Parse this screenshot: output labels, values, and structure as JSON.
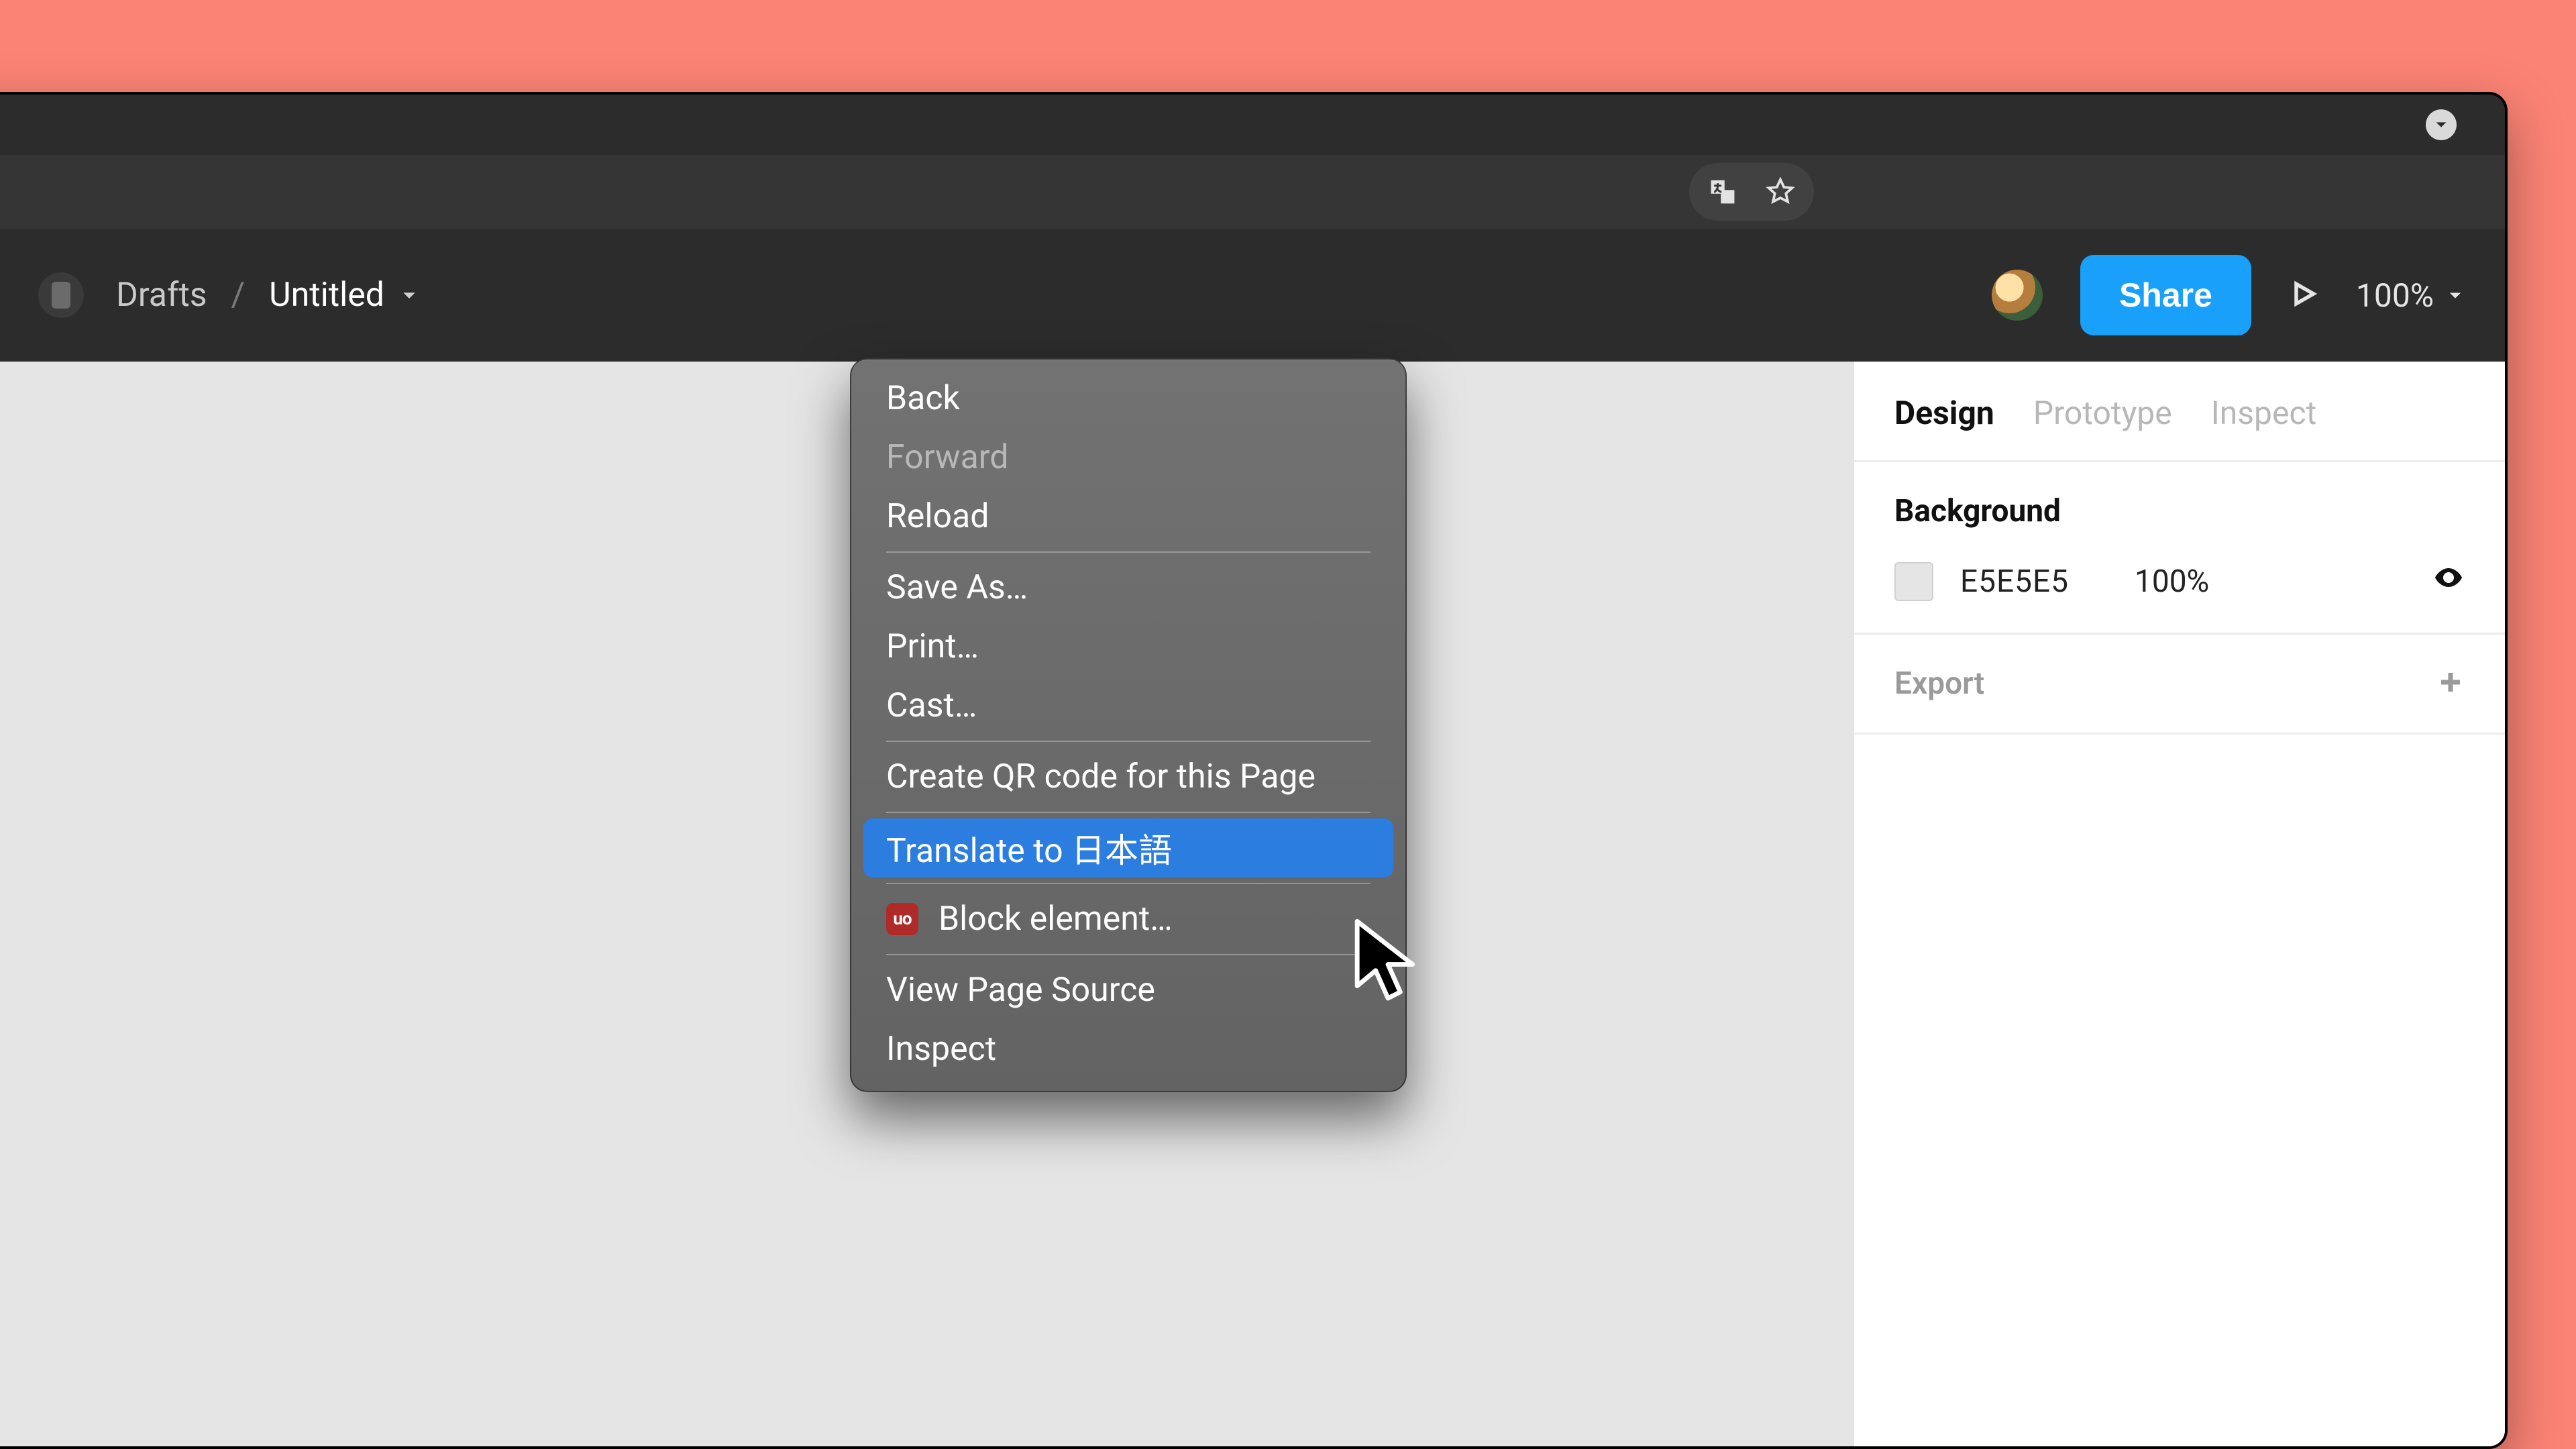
{
  "header": {
    "drafts_label": "Drafts",
    "slash": "/",
    "title": "Untitled",
    "share_label": "Share",
    "zoom_label": "100%"
  },
  "right_panel": {
    "tabs": {
      "design": "Design",
      "prototype": "Prototype",
      "inspect": "Inspect"
    },
    "background": {
      "title": "Background",
      "hex": "E5E5E5",
      "opacity": "100%"
    },
    "export_label": "Export"
  },
  "context_menu": {
    "back": "Back",
    "forward": "Forward",
    "reload": "Reload",
    "save_as": "Save As…",
    "print": "Print…",
    "cast": "Cast…",
    "qr": "Create QR code for this Page",
    "translate": "Translate to 日本語",
    "block_icon": "uo",
    "block": "Block element…",
    "view_source": "View Page Source",
    "inspect": "Inspect"
  }
}
